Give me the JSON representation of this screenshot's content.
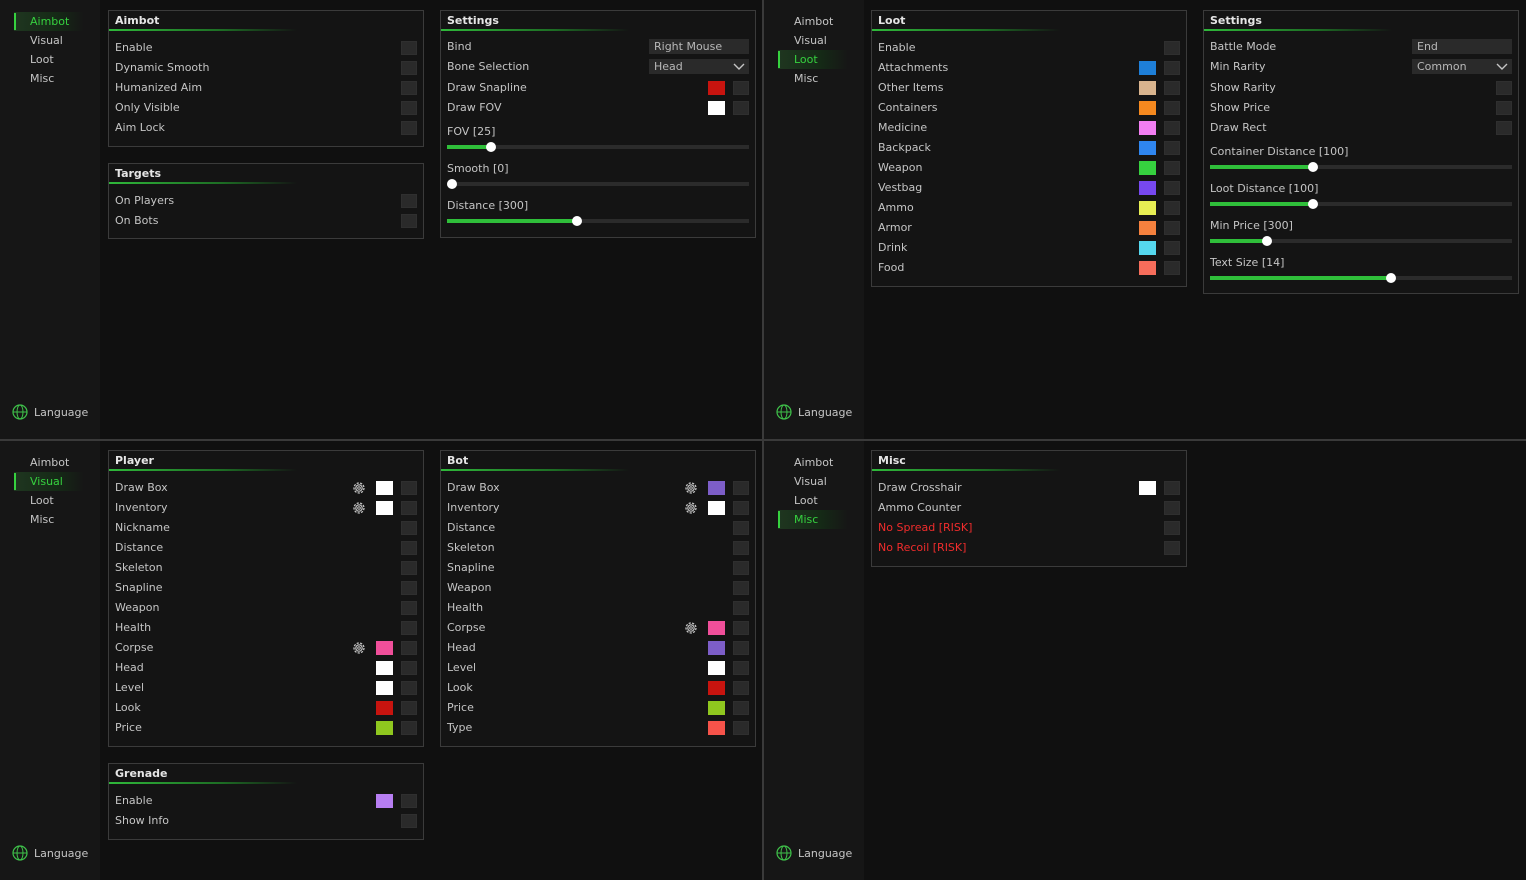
{
  "nav": [
    "Aimbot",
    "Visual",
    "Loot",
    "Misc"
  ],
  "language_label": "Language",
  "icons": {
    "globe": "globe-icon",
    "gear": "gear-icon",
    "chevron": "chevron-down-icon"
  },
  "colors": {
    "accent": "#36d13f",
    "risk": "#f02c2c",
    "checkbox": "#2a2a2a"
  },
  "aimbot": {
    "active_nav": "Aimbot",
    "aimbot_panel": {
      "title": "Aimbot",
      "rows": [
        "Enable",
        "Dynamic Smooth",
        "Humanized Aim",
        "Only Visible",
        "Aim Lock"
      ]
    },
    "targets_panel": {
      "title": "Targets",
      "rows": [
        "On Players",
        "On Bots"
      ]
    },
    "settings_panel": {
      "title": "Settings",
      "bind": {
        "label": "Bind",
        "value": "Right Mouse"
      },
      "bone": {
        "label": "Bone Selection",
        "value": "Head"
      },
      "draw_snapline": {
        "label": "Draw Snapline",
        "color": "#c8140f"
      },
      "draw_fov": {
        "label": "Draw FOV",
        "color": "#ffffff"
      },
      "sliders": [
        {
          "label": "FOV [25]",
          "value": 25,
          "fraction": 0.145
        },
        {
          "label": "Smooth [0]",
          "value": 0,
          "fraction": 0.0
        },
        {
          "label": "Distance [300]",
          "value": 300,
          "fraction": 0.43
        }
      ]
    }
  },
  "loot": {
    "active_nav": "Loot",
    "loot_panel": {
      "title": "Loot",
      "rows": [
        {
          "label": "Enable",
          "color": null
        },
        {
          "label": "Attachments",
          "color": "#1e7fd8"
        },
        {
          "label": "Other Items",
          "color": "#d9b48e"
        },
        {
          "label": "Containers",
          "color": "#f5891f"
        },
        {
          "label": "Medicine",
          "color": "#f27ef2"
        },
        {
          "label": "Backpack",
          "color": "#2f86ef"
        },
        {
          "label": "Weapon",
          "color": "#36d13f"
        },
        {
          "label": "Vestbag",
          "color": "#7748ef"
        },
        {
          "label": "Ammo",
          "color": "#e7ee53"
        },
        {
          "label": "Armor",
          "color": "#f5813e"
        },
        {
          "label": "Drink",
          "color": "#55d7ee"
        },
        {
          "label": "Food",
          "color": "#f66d5b"
        }
      ]
    },
    "settings_panel": {
      "title": "Settings",
      "battle_mode": {
        "label": "Battle Mode",
        "value": "End"
      },
      "min_rarity": {
        "label": "Min Rarity",
        "value": "Common"
      },
      "toggles": [
        "Show Rarity",
        "Show Price",
        "Draw Rect"
      ],
      "sliders": [
        {
          "label": "Container Distance [100]",
          "value": 100,
          "fraction": 0.34
        },
        {
          "label": "Loot Distance [100]",
          "value": 100,
          "fraction": 0.34
        },
        {
          "label": "Min Price [300]",
          "value": 300,
          "fraction": 0.19
        },
        {
          "label": "Text Size [14]",
          "value": 14,
          "fraction": 0.6
        }
      ]
    }
  },
  "visual": {
    "active_nav": "Visual",
    "player_panel": {
      "title": "Player",
      "rows": [
        {
          "label": "Draw Box",
          "gear": true,
          "color": "#ffffff"
        },
        {
          "label": "Inventory",
          "gear": true,
          "color": "#ffffff"
        },
        {
          "label": "Nickname",
          "gear": false,
          "color": null
        },
        {
          "label": "Distance",
          "gear": false,
          "color": null
        },
        {
          "label": "Skeleton",
          "gear": false,
          "color": null
        },
        {
          "label": "Snapline",
          "gear": false,
          "color": null
        },
        {
          "label": "Weapon",
          "gear": false,
          "color": null
        },
        {
          "label": "Health",
          "gear": false,
          "color": null
        },
        {
          "label": "Corpse",
          "gear": true,
          "color": "#f04f9a"
        },
        {
          "label": "Head",
          "gear": false,
          "color": "#ffffff"
        },
        {
          "label": "Level",
          "gear": false,
          "color": "#ffffff"
        },
        {
          "label": "Look",
          "gear": false,
          "color": "#c8140f"
        },
        {
          "label": "Price",
          "gear": false,
          "color": "#8fc71f"
        }
      ]
    },
    "bot_panel": {
      "title": "Bot",
      "rows": [
        {
          "label": "Draw Box",
          "gear": true,
          "color": "#7d5ec8"
        },
        {
          "label": "Inventory",
          "gear": true,
          "color": "#ffffff"
        },
        {
          "label": "Distance",
          "gear": false,
          "color": null
        },
        {
          "label": "Skeleton",
          "gear": false,
          "color": null
        },
        {
          "label": "Snapline",
          "gear": false,
          "color": null
        },
        {
          "label": "Weapon",
          "gear": false,
          "color": null
        },
        {
          "label": "Health",
          "gear": false,
          "color": null
        },
        {
          "label": "Corpse",
          "gear": true,
          "color": "#f04f9a"
        },
        {
          "label": "Head",
          "gear": false,
          "color": "#7d5ec8"
        },
        {
          "label": "Level",
          "gear": false,
          "color": "#ffffff"
        },
        {
          "label": "Look",
          "gear": false,
          "color": "#c8140f"
        },
        {
          "label": "Price",
          "gear": false,
          "color": "#8fc71f"
        },
        {
          "label": "Type",
          "gear": false,
          "color": "#f6534a"
        }
      ]
    },
    "grenade_panel": {
      "title": "Grenade",
      "rows": [
        {
          "label": "Enable",
          "color": "#b77ef2"
        },
        {
          "label": "Show Info",
          "color": null
        }
      ]
    }
  },
  "misc": {
    "active_nav": "Misc",
    "misc_panel": {
      "title": "Misc",
      "rows": [
        {
          "label": "Draw Crosshair",
          "color": "#ffffff",
          "risk": false
        },
        {
          "label": "Ammo Counter",
          "color": null,
          "risk": false
        },
        {
          "label": "No Spread [RISK]",
          "color": null,
          "risk": true
        },
        {
          "label": "No Recoil [RISK]",
          "color": null,
          "risk": true
        }
      ]
    }
  }
}
